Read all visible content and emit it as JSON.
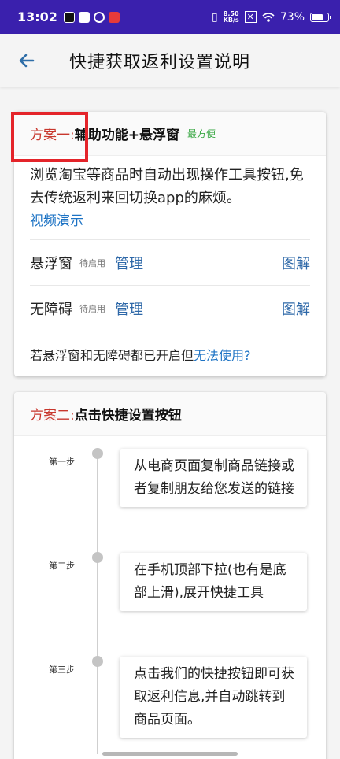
{
  "status_bar": {
    "time": "13:02",
    "net_speed_value": "8.50",
    "net_speed_unit": "KB/s",
    "battery": "73%",
    "battery_level": 0.73
  },
  "header": {
    "title": "快捷获取返利设置说明"
  },
  "plan1": {
    "prefix": "方案一:",
    "title": "辅助功能+悬浮窗",
    "tag": "最方便",
    "description": "浏览淘宝等商品时自动出现操作工具按钮,免去传统返利来回切换app的麻烦。",
    "video_link": "视频演示",
    "rows": [
      {
        "name": "悬浮窗",
        "state": "待启用",
        "manage": "管理",
        "diagram": "图解"
      },
      {
        "name": "无障碍",
        "state": "待启用",
        "manage": "管理",
        "diagram": "图解"
      }
    ],
    "question": "若悬浮窗和无障碍都已开启但",
    "question_link": "无法使用?"
  },
  "plan2": {
    "prefix": "方案二:",
    "title": "点击快捷设置按钮",
    "steps": [
      {
        "label": "第一步",
        "text": "从电商页面复制商品链接或者复制朋友给您发送的链接"
      },
      {
        "label": "第二步",
        "text": "在手机顶部下拉(也有是底部上滑),展开快捷工具"
      },
      {
        "label": "第三步",
        "text": "点击我们的快捷按钮即可获取返利信息,并自动跳转到商品页面。"
      }
    ]
  },
  "colors": {
    "status_bar": "#3a20ad",
    "accent_red": "#c8372d",
    "link_blue": "#2e68a8",
    "tag_green": "#3aa845",
    "highlight_box": "#e4242a"
  }
}
